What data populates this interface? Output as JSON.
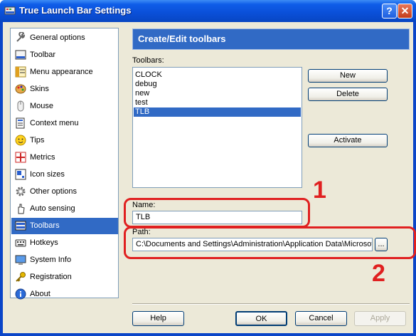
{
  "window": {
    "title": "True Launch Bar Settings",
    "help_glyph": "?",
    "close_glyph": "✕"
  },
  "sidebar": {
    "items": [
      {
        "label": "General options",
        "icon": "wrench-icon"
      },
      {
        "label": "Toolbar",
        "icon": "toolbar-icon"
      },
      {
        "label": "Menu appearance",
        "icon": "menu-icon"
      },
      {
        "label": "Skins",
        "icon": "palette-icon"
      },
      {
        "label": "Mouse",
        "icon": "mouse-icon"
      },
      {
        "label": "Context menu",
        "icon": "context-menu-icon"
      },
      {
        "label": "Tips",
        "icon": "tips-icon"
      },
      {
        "label": "Metrics",
        "icon": "metrics-icon"
      },
      {
        "label": "Icon sizes",
        "icon": "icon-sizes-icon"
      },
      {
        "label": "Other options",
        "icon": "gear-icon"
      },
      {
        "label": "Auto sensing",
        "icon": "hand-icon"
      },
      {
        "label": "Toolbars",
        "icon": "toolbars-icon",
        "selected": true
      },
      {
        "label": "Hotkeys",
        "icon": "hotkeys-icon"
      },
      {
        "label": "System Info",
        "icon": "monitor-icon"
      },
      {
        "label": "Registration",
        "icon": "key-icon"
      },
      {
        "label": "About",
        "icon": "info-icon"
      }
    ]
  },
  "main": {
    "header": "Create/Edit toolbars",
    "toolbars_label": "Toolbars:",
    "toolbars": [
      "CLOCK",
      "debug",
      "new",
      "test",
      "TLB"
    ],
    "selected_toolbar": "TLB",
    "buttons": {
      "new": "New",
      "delete": "Delete",
      "activate": "Activate"
    },
    "name_label": "Name:",
    "name_value": "TLB",
    "path_label": "Path:",
    "path_value": "C:\\Documents and Settings\\Administration\\Application Data\\Microsof",
    "browse_label": "..."
  },
  "annotations": {
    "marker_1": "1",
    "marker_2": "2",
    "color": "#e02020"
  },
  "footer": {
    "help": "Help",
    "ok": "OK",
    "cancel": "Cancel",
    "apply": "Apply"
  },
  "colors": {
    "selection": "#316ac5",
    "titlebar": "#0a4fd8",
    "dialog_bg": "#ece9d8"
  }
}
